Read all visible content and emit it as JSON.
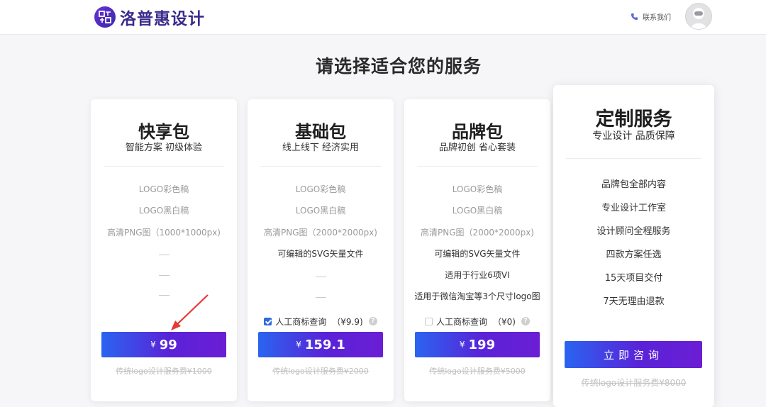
{
  "header": {
    "brand": "洛普惠设计",
    "contact_label": "联系我们"
  },
  "main": {
    "title": "请选择适合您的服务"
  },
  "packages": [
    {
      "name": "快享包",
      "subtitle": "智能方案 初级体验",
      "features": [
        "LOGO彩色稿",
        "LOGO黑白稿",
        "高清PNG图（1000*1000px)"
      ],
      "price_symbol": "¥",
      "price": "99",
      "original_price": "传统logo设计服务费¥1000"
    },
    {
      "name": "基础包",
      "subtitle": "线上线下 经济实用",
      "features": [
        "LOGO彩色稿",
        "LOGO黑白稿",
        "高清PNG图（2000*2000px)",
        "可编辑的SVG矢量文件"
      ],
      "addon": {
        "label": "人工商标查询",
        "price": "（¥9.9)",
        "checked": true,
        "help_icon": "question-icon"
      },
      "price_symbol": "¥",
      "price": "159.1",
      "original_price": "传统logo设计服务费¥2000"
    },
    {
      "name": "品牌包",
      "subtitle": "品牌初创 省心套装",
      "features": [
        "LOGO彩色稿",
        "LOGO黑白稿",
        "高清PNG图（2000*2000px)",
        "可编辑的SVG矢量文件",
        "适用于行业6项VI",
        "适用于微信淘宝等3个尺寸logo图"
      ],
      "addon": {
        "label": "人工商标查询",
        "price": "（¥0)",
        "checked": false,
        "help_icon": "question-icon"
      },
      "price_symbol": "¥",
      "price": "199",
      "original_price": "传统logo设计服务费¥5000"
    },
    {
      "name": "定制服务",
      "subtitle": "专业设计 品质保障",
      "features": [
        "品牌包全部内容",
        "专业设计工作室",
        "设计顾问全程服务",
        "四款方案任选",
        "15天项目交付",
        "7天无理由退款"
      ],
      "button_label": "立即咨询",
      "original_price": "传统logo设计服务费¥8000"
    }
  ],
  "colors": {
    "button_gradient_start": "#2a64f0",
    "button_gradient_end": "#6b1ed4",
    "arrow": "#e53935",
    "brand": "#3b2b8c"
  }
}
